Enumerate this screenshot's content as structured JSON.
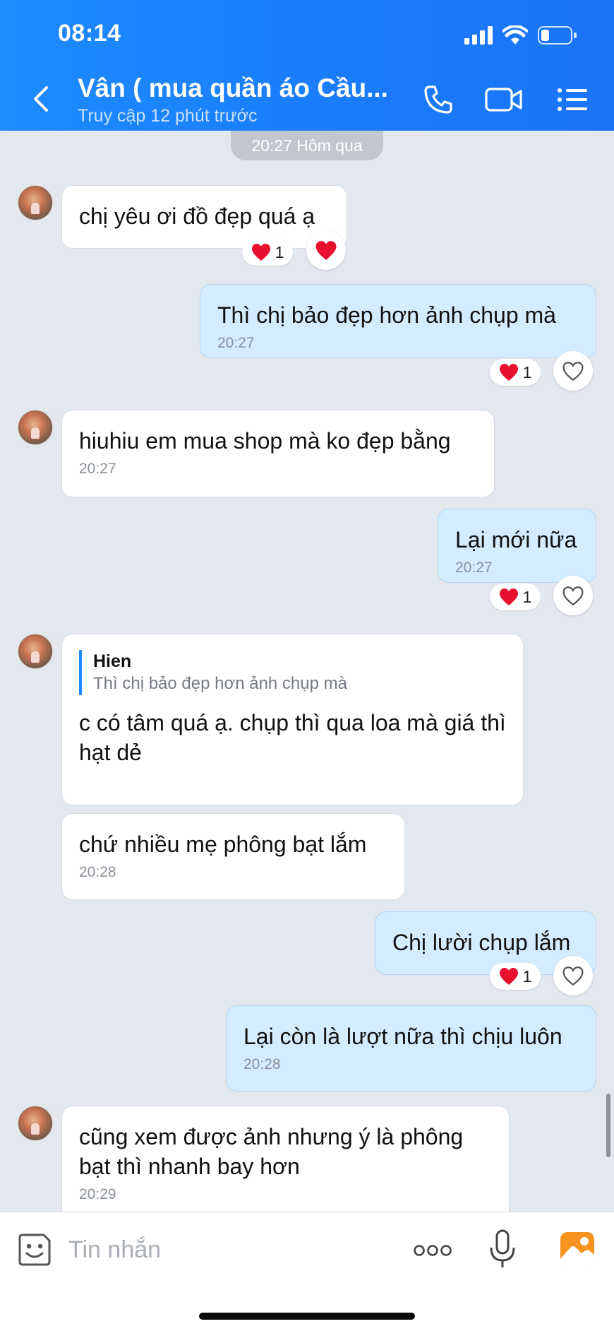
{
  "status_bar": {
    "time": "08:14"
  },
  "header": {
    "title": "Vân ( mua quần áo  Cầu...",
    "subtitle": "Truy cập 12 phút trước"
  },
  "chat": {
    "date_chip": "20:27 Hôm qua",
    "messages": [
      {
        "text": "chị yêu ơi đồ đẹp quá ạ",
        "reaction_count": "1"
      },
      {
        "text": "Thì chị bảo đẹp hơn ảnh chụp mà",
        "time": "20:27",
        "reaction_count": "1"
      },
      {
        "text": "hiuhiu em mua shop mà ko đẹp bằng",
        "time": "20:27"
      },
      {
        "text": "Lại mới nữa",
        "time": "20:27",
        "reaction_count": "1"
      },
      {
        "quote_author": "Hien",
        "quote_text": "Thì chị bảo đẹp hơn ảnh chụp mà",
        "text": "c có tâm quá ạ. chụp thì qua loa mà giá thì hạt dẻ"
      },
      {
        "text": "chứ nhiều mẹ phông bạt lắm",
        "time": "20:28"
      },
      {
        "text": "Chị lười chụp lắm",
        "reaction_count": "1"
      },
      {
        "text": "Lại còn là lượt nữa thì chịu luôn",
        "time": "20:28"
      },
      {
        "text": "cũng xem được ảnh nhưng ý là phông bạt thì nhanh bay hơn",
        "time": "20:29"
      }
    ]
  },
  "input": {
    "placeholder": "Tin nhắn"
  },
  "colors": {
    "header_blue": "#1A7BFB",
    "outgoing_bubble": "#D4ECFF",
    "incoming_bubble": "#FFFFFF",
    "chat_background": "#E3E7EE",
    "heart_red": "#E8102F"
  }
}
